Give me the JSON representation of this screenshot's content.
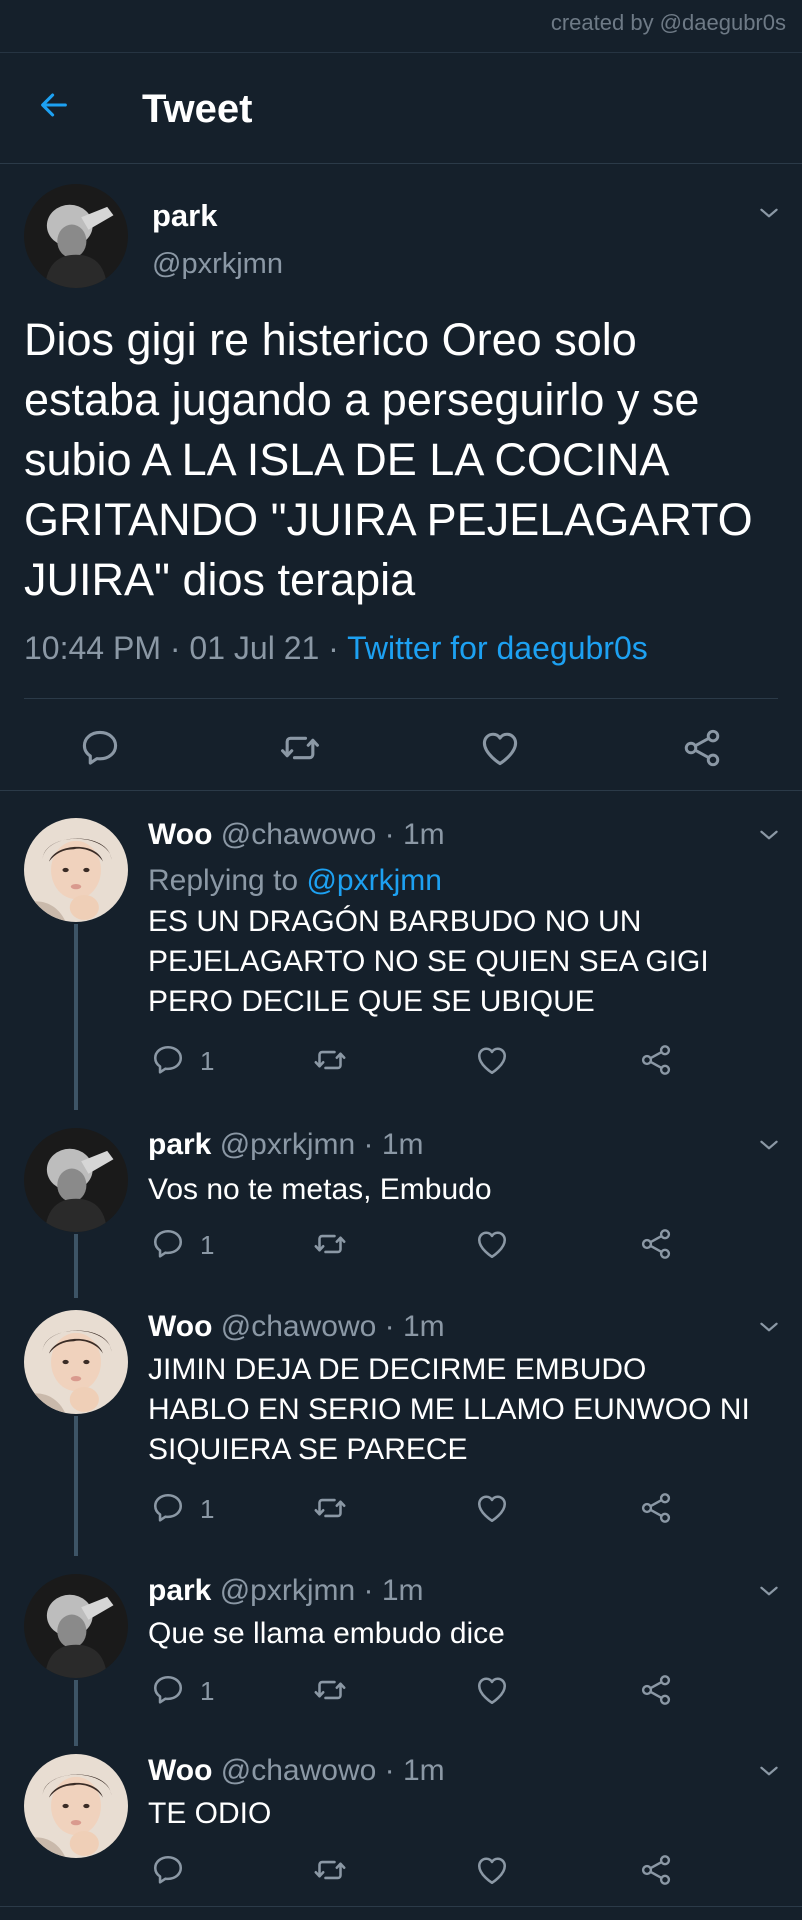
{
  "credit": "created by @daegubr0s",
  "header": {
    "title": "Tweet",
    "back_icon": "arrow-left-icon"
  },
  "colors": {
    "background": "#15202b",
    "accent": "#1da1f2",
    "muted": "#8b98a5",
    "divider": "#2b3a48"
  },
  "main_tweet": {
    "name": "park",
    "handle": "@pxrkjmn",
    "text": "Dios gigi re histerico Oreo solo\nestaba jugando a perseguirlo y se\nsubio A LA ISLA DE LA COCINA\nGRITANDO \"JUIRA PEJELAGARTO\nJUIRA\" dios terapia",
    "time": "10:44 PM",
    "separator": "·",
    "date": "01 Jul 21",
    "source": "Twitter for daegubr0s"
  },
  "replies": [
    {
      "name": "Woo",
      "handle": "@chawowo",
      "time": "· 1m",
      "replying_label": "Replying to",
      "replying_handle": "@pxrkjmn",
      "text": "ES UN DRAGÓN BARBUDO NO UN\nPEJELAGARTO NO SE QUIEN SEA GIGI\nPERO DECILE QUE SE UBIQUE",
      "reply_count": "1"
    },
    {
      "name": "park",
      "handle": "@pxrkjmn",
      "time": "· 1m",
      "text": "Vos no te metas, Embudo",
      "reply_count": "1"
    },
    {
      "name": "Woo",
      "handle": "@chawowo",
      "time": "· 1m",
      "text": "JIMIN DEJA DE DECIRME EMBUDO\nHABLO EN SERIO ME LLAMO EUNWOO NI\nSIQUIERA SE PARECE",
      "reply_count": "1"
    },
    {
      "name": "park",
      "handle": "@pxrkjmn",
      "time": "· 1m",
      "text": "Que se llama embudo dice",
      "reply_count": "1"
    },
    {
      "name": "Woo",
      "handle": "@chawowo",
      "time": "· 1m",
      "text": "TE ODIO",
      "reply_count": ""
    }
  ],
  "icons": {
    "reply": "reply-bubble-icon",
    "retweet": "retweet-icon",
    "like": "heart-icon",
    "share": "share-icon",
    "menu": "chevron-down-icon"
  }
}
